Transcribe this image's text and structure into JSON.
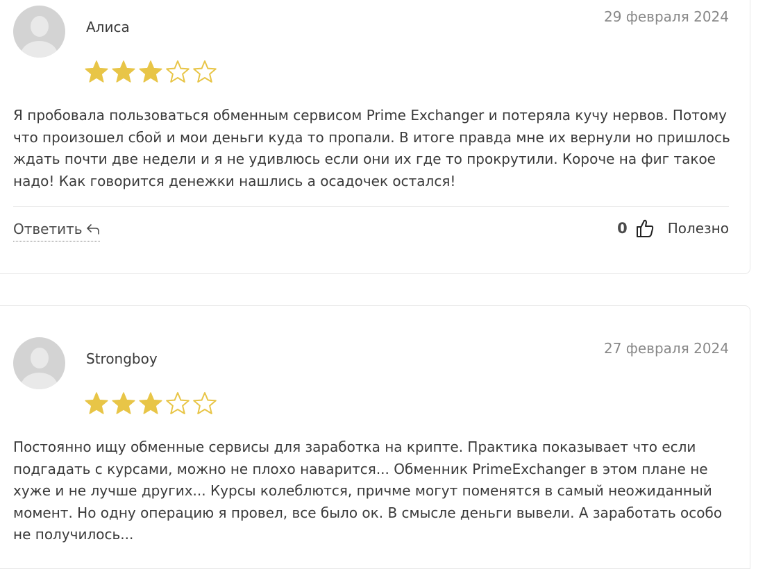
{
  "reviews": [
    {
      "author": "Алиса",
      "date": "29 февраля 2024",
      "rating": 3,
      "max_rating": 5,
      "text": "Я пробовала пользоваться обменным сервисом Prime Exchanger и потеряла кучу нервов. Потому что произошел сбой и мои деньги куда то пропали. В итоге правда мне их вернули но пришлось ждать почти две недели и я не удивлюсь если они их где то прокрутили. Короче на фиг такое надо! Как говорится денежки нашлись а осадочек остался!",
      "reply_label": "Ответить",
      "likes": "0",
      "helpful_label": "Полезно"
    },
    {
      "author": "Strongboy",
      "date": "27 февраля 2024",
      "rating": 3,
      "max_rating": 5,
      "text": "Постоянно ищу обменные сервисы для заработка на крипте. Практика показывает что если подгадать с курсами, можно не плохо наварится... Обменник PrimeExchanger в этом плане не хуже и не лучше других... Курсы колеблются, причме могут поменятся в самый неожиданный момент. Но одну операцию я провел, все было ок. В смысле деньги вывели. А заработать особо не получилось..."
    }
  ],
  "colors": {
    "star_filled": "#e8c547",
    "star_empty_stroke": "#e8c547",
    "avatar_bg": "#d3d3d3",
    "date_text": "#888888",
    "body_text": "#3a3a3a"
  },
  "icons": {
    "reply": "reply-arrow-icon",
    "like": "thumbs-up-icon",
    "avatar": "user-placeholder-icon",
    "star": "star-icon"
  }
}
